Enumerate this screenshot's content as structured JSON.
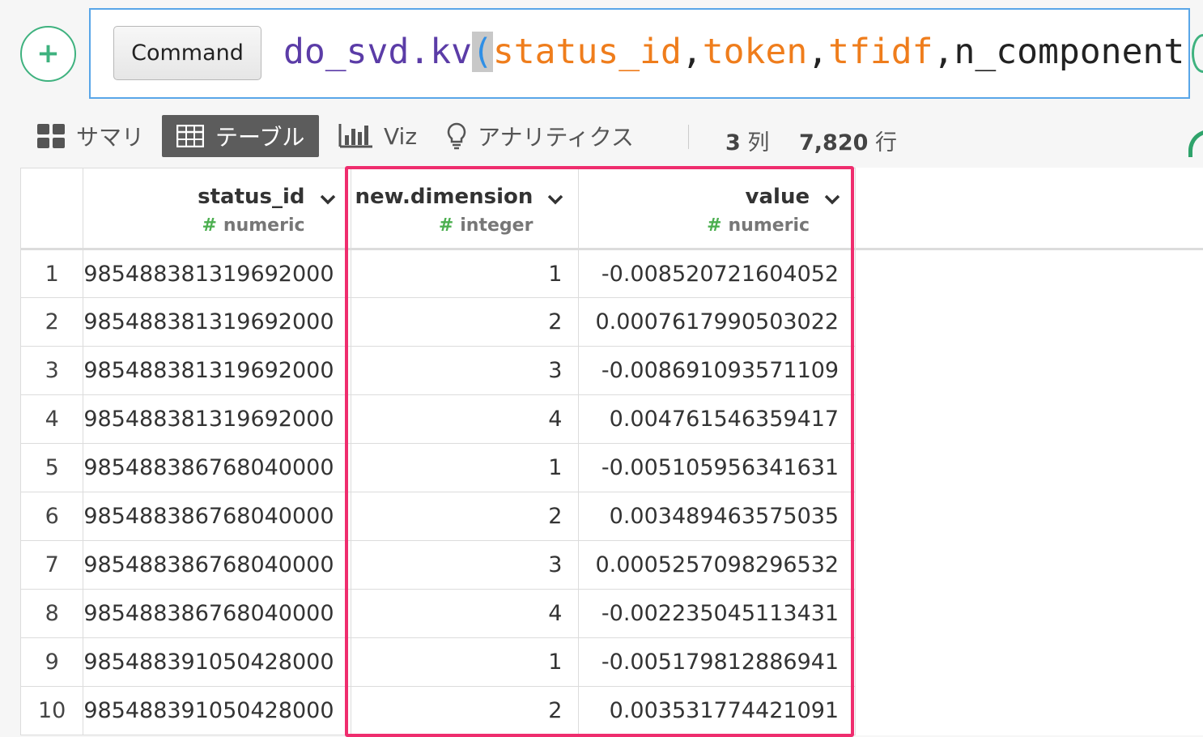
{
  "command": {
    "add_symbol": "+",
    "type_label": "Command",
    "code": {
      "fn": "do_svd.kv",
      "open_paren": "(",
      "args": [
        "status_id",
        "token",
        "tfidf"
      ],
      "comma": ",",
      "tail": "n_component"
    }
  },
  "tabs": [
    {
      "label": "サマリ",
      "icon": "grid-icon"
    },
    {
      "label": "テーブル",
      "icon": "table-icon",
      "active": true
    },
    {
      "label": "Viz",
      "icon": "bar-chart-icon"
    },
    {
      "label": "アナリティクス",
      "icon": "lightbulb-icon"
    }
  ],
  "stats": {
    "columns_count": "3",
    "columns_unit": "列",
    "rows_count": "7,820",
    "rows_unit": "行"
  },
  "table": {
    "hash_symbol": "#",
    "columns": [
      {
        "name": "status_id",
        "type": "numeric"
      },
      {
        "name": "new.dimension",
        "type": "integer"
      },
      {
        "name": "value",
        "type": "numeric"
      }
    ],
    "rows": [
      {
        "n": "1",
        "status_id": "985488381319692000",
        "dim": "1",
        "value": "-0.008520721604052"
      },
      {
        "n": "2",
        "status_id": "985488381319692000",
        "dim": "2",
        "value": "0.0007617990503022"
      },
      {
        "n": "3",
        "status_id": "985488381319692000",
        "dim": "3",
        "value": "-0.008691093571109"
      },
      {
        "n": "4",
        "status_id": "985488381319692000",
        "dim": "4",
        "value": "0.004761546359417"
      },
      {
        "n": "5",
        "status_id": "985488386768040000",
        "dim": "1",
        "value": "-0.005105956341631"
      },
      {
        "n": "6",
        "status_id": "985488386768040000",
        "dim": "2",
        "value": "0.003489463575035"
      },
      {
        "n": "7",
        "status_id": "985488386768040000",
        "dim": "3",
        "value": "0.0005257098296532"
      },
      {
        "n": "8",
        "status_id": "985488386768040000",
        "dim": "4",
        "value": "-0.002235045113431"
      },
      {
        "n": "9",
        "status_id": "985488391050428000",
        "dim": "1",
        "value": "-0.005179812886941"
      },
      {
        "n": "10",
        "status_id": "985488391050428000",
        "dim": "2",
        "value": "0.003531774421091"
      }
    ]
  },
  "colors": {
    "accent_green": "#3fb27f",
    "highlight_pink": "#ef2d6e",
    "command_border": "#59a6e8"
  }
}
